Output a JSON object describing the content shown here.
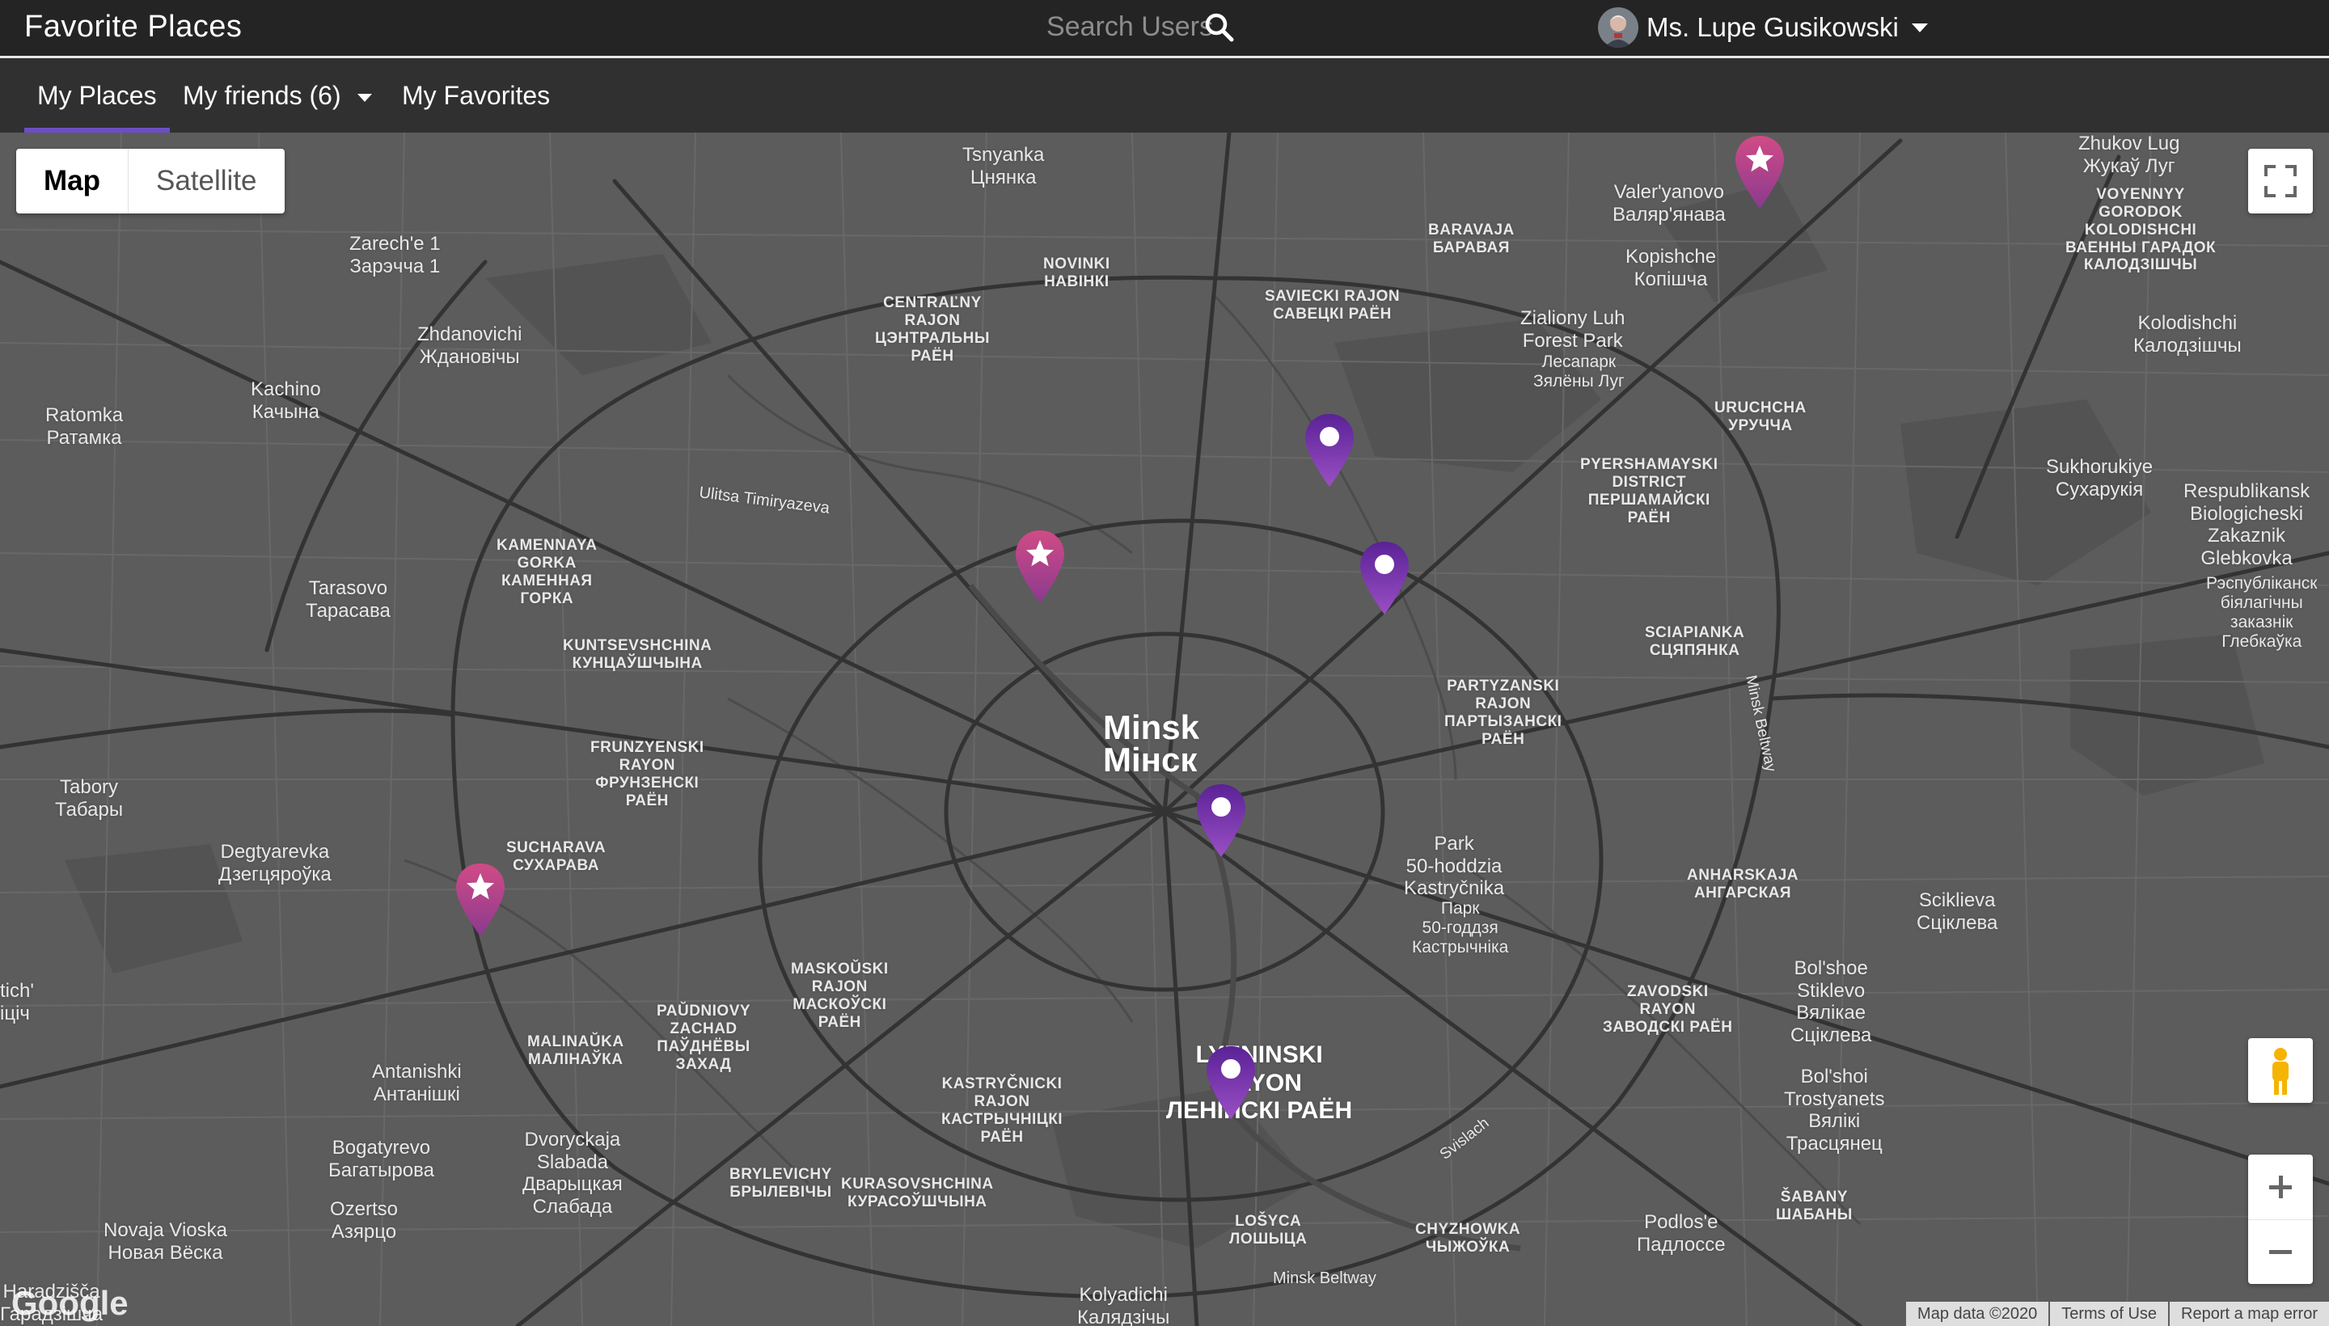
{
  "navbar": {
    "app_title": "Favorite Places",
    "search_placeholder": "Search Users",
    "search_icon": "search-icon",
    "user_name": "Ms. Lupe Gusikowski"
  },
  "tabs": [
    {
      "label": "My Places",
      "active": true
    },
    {
      "label": "My friends (6)",
      "dropdown": true
    },
    {
      "label": "My Favorites"
    }
  ],
  "map": {
    "type_controls": {
      "map": "Map",
      "satellite": "Satellite",
      "selected": "Map"
    },
    "labels": {
      "minsk": "Minsk",
      "minsk_cyr": "Мінск",
      "tsnyanka": "Tsnyanka\nЦнянка",
      "zarechye": "Zarech'e 1\nЗарэчча 1",
      "zhdanovichi": "Zhdanovichi\nЖдановічы",
      "kachino": "Kachino\nКачына",
      "ratomka": "Ratomka\nРатамка",
      "tarasovo": "Tarasovo\nТарасава",
      "tabory": "Tabory\nТабары",
      "degtyarevka": "Degtyarevka\nДзегцяроўка",
      "antanishki": "Antanishki\nАнтанішкі",
      "bogatyrevo": "Bogatyrevo\nБагатырова",
      "ozertso": "Ozertso\nАзярцо",
      "novaja_viosk": "Novaja Vioska\nНовая Вёска",
      "haradzisca": "Haradzišča\nГарадзішча",
      "dvorysk": "Dvoryckaja\nSlabada\nДварыцкая\nСлабада",
      "kolyadichi": "Kolyadichi\nКалядзічы",
      "valeryanovo": "Valer'yanovo\nВаляр'янава",
      "kopishche": "Kopishche\nКопішча",
      "zhukov_lug": "Zhukov Lug\nЖукаў Луг",
      "kolodishchi": "Kolodishchi\nКалодзішчы",
      "sukhorukiye": "Sukhorukiye\nСухарукія",
      "respublikansk": "Respublikansk\nBiologicheski\nZakaznik\nGlebkovka",
      "respublikansk_cyr": "Рэспубліканск\nбіялагічны\nзаказнік\nГлебкаўка",
      "sciklieva": "Sciklieva\nСціклева",
      "bolshoe_stiklevo": "Bol'shoe\nStiklevo\nВялікае\nСціклева",
      "bolshoi_trostyanets": "Bol'shoi\nTrostyanets\nВялікі\nТрасцянец",
      "podlosye": "Podlos'e\nПадлоссе",
      "park": "Park\n50-hoddzia\nKastryčnika",
      "park_cyr": "Парк\n50-годдзя\nКастрычніка",
      "zialiony_luh": "Zialiony Luh\nForest Park",
      "zialiony_luh_cyr": "Лесапарк\nЗялёны Луг",
      "lyeninski": "LYENINSKI\nRAYON\nЛЕНІНСКІ РАЁН",
      "novinki": "NOVINKI\nНАВІНКІ",
      "centralny": "CENTRAĽNY\nRAJON\nЦЭНТРАЛЬНЫ\nРАЁН",
      "saviecki": "SAVIECKI RAJON\nСАВЕЦКІ РАЁН",
      "baravaja": "BARAVAJA\nБАРАВАЯ",
      "voyennyy": "VOYENNYY\nGORODOK\nKOLODISHCHI\nВАЕННЫ ГАРАДОК\nКАЛОДЗІШЧЫ",
      "uruchcha": "URUCHCHA\nУРУЧЧА",
      "pyershamayski": "PYERSHAMAYSKI\nDISTRICT\nПЕРШАМАЙСКІ\nРАЁН",
      "sciapianka": "SCIAPIANKA\nСЦЯПЯНКА",
      "partyzanski": "PARTYZANSKI\nRAJON\nПАРТЫЗАНСКІ\nРАЁН",
      "anharskaja": "ANHARSKAJA\nАНГАРСКАЯ",
      "zavodski": "ZAVODSKI\nRAYON\nЗАВОДСКІ РАЁН",
      "sabany": "ŠABANY\nШАБАНЫ",
      "chyzhowka": "CHYZHOWKA\nЧЫЖОЎКА",
      "losyca": "LOŠYCA\nЛОШЫЦА",
      "kastrycnicki": "KASTRYČNICKI\nRAJON\nКАСТРЫЧНІЦКІ\nРАЁН",
      "kurasovshchina": "KURASOVSHCHINA\nКУРАСОЎШЧЫНА",
      "brylevichy": "BRYLEVICHY\nБРЫЛЕВІЧЫ",
      "malinauka": "MALINAŬKA\nМАЛІНАЎКА",
      "paudnovy": "PAŬDNIOVY\nZACHAD\nПАЎДНЁВЫ\nЗАХАД",
      "maskouski": "MASKOŬSKI\nRAJON\nМАСКОЎСКІ\nРАЁН",
      "sucharava": "SUCHARAVA\nСУХАРАВА",
      "frunzyenski": "FRUNZYENSKI\nRAYON\nФРУНЗЕНСКІ\nРАЁН",
      "kuntsevshchina": "KUNTSEVSHCHINA\nКУНЦАЎШЧЫНА",
      "kamennaya": "KAMENNAYA\nGORKA\nКАМЕННАЯ\nГОРКА",
      "ulitsa": "Ulitsa Timiryazeva",
      "minsk_beltway_v": "Minsk Beltway",
      "minsk_beltway_h": "Minsk Beltway",
      "svislach": "Svislach",
      "tich_left": "tich'\nіціч",
      "google": "Google"
    },
    "markers": [
      {
        "kind": "favorite",
        "icon": "star-icon"
      },
      {
        "kind": "favorite",
        "icon": "star-icon"
      },
      {
        "kind": "favorite",
        "icon": "star-icon"
      },
      {
        "kind": "place",
        "icon": "dot-icon"
      },
      {
        "kind": "place",
        "icon": "dot-icon"
      },
      {
        "kind": "place",
        "icon": "dot-icon"
      },
      {
        "kind": "place",
        "icon": "dot-icon"
      }
    ],
    "footer": {
      "map_data": "Map data ©2020",
      "terms": "Terms of Use",
      "report": "Report a map error"
    },
    "colors": {
      "place_marker": "#6a2fa3",
      "favorite_marker": "#c0457f",
      "map_bg": "#5c5c5c"
    }
  }
}
